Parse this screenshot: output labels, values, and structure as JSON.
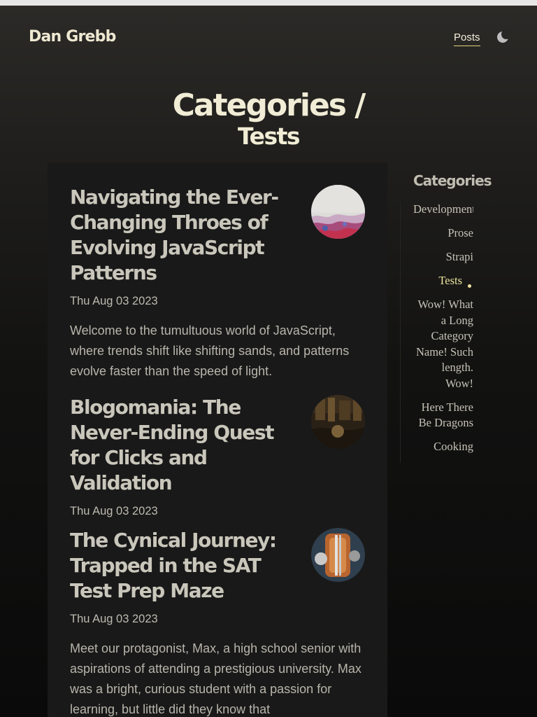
{
  "site": {
    "title": "Dan Grebb"
  },
  "nav": {
    "posts_label": "Posts"
  },
  "theme_toggle": {
    "icon": "moon-icon"
  },
  "heading": {
    "main": "Categories /",
    "sub": "Tests"
  },
  "posts": [
    {
      "title": "Navigating the Ever-Changing Throes of Evolving JavaScript Patterns",
      "date": "Thu Aug 03 2023",
      "excerpt": "Welcome to the tumultuous world of JavaScript, where trends shift like shifting sands, and patterns evolve faster than the speed of light."
    },
    {
      "title": "Blogomania: The Never-Ending Quest for Clicks and Validation",
      "date": "Thu Aug 03 2023",
      "excerpt": ""
    },
    {
      "title": "The Cynical Journey: Trapped in the SAT Test Prep Maze",
      "date": "Thu Aug 03 2023",
      "excerpt": "Meet our protagonist, Max, a high school senior with aspirations of attending a prestigious university. Max was a bright, curious student with a passion for learning, but little did they know that"
    }
  ],
  "sidebar": {
    "title": "Categories",
    "categories": [
      "Development",
      "Prose",
      "Strapi",
      "Tests",
      "Wow! What a Long Category Name! Such length. Wow!",
      "Here There Be Dragons",
      "Cooking"
    ],
    "active": "Tests",
    "accent_color": "#ece39d"
  }
}
